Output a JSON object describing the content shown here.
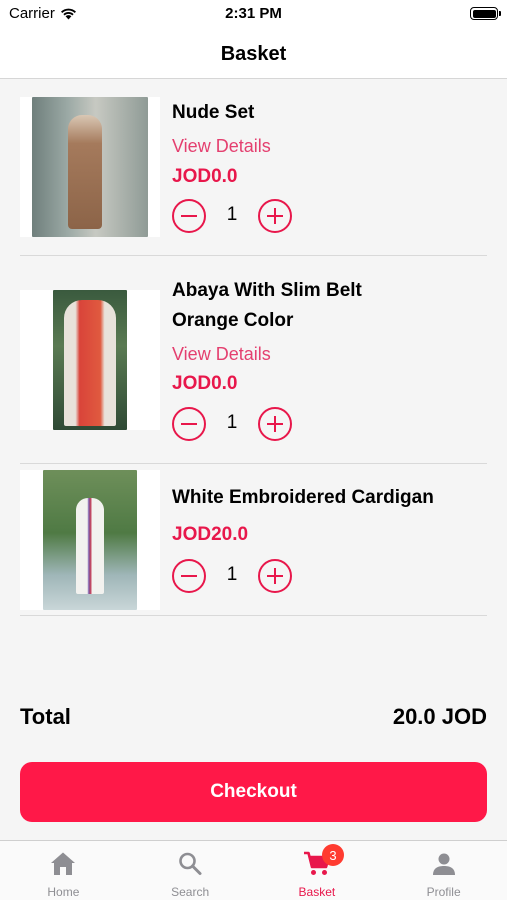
{
  "status_bar": {
    "carrier": "Carrier",
    "time": "2:31 PM"
  },
  "header": {
    "title": "Basket"
  },
  "basket": {
    "items": [
      {
        "name_lines": [
          "Nude Set"
        ],
        "view_details": "View Details",
        "price": "JOD0.0",
        "quantity": "1"
      },
      {
        "name_lines": [
          "Abaya With Slim Belt",
          "Orange Color"
        ],
        "view_details": "View Details",
        "price": "JOD0.0",
        "quantity": "1"
      },
      {
        "name_lines": [
          "White Embroidered Cardigan"
        ],
        "price": "JOD20.0",
        "quantity": "1"
      }
    ]
  },
  "summary": {
    "total_label": "Total",
    "total_value": "20.0 JOD"
  },
  "checkout_label": "Checkout",
  "tab_bar": {
    "tabs": [
      {
        "label": "Home",
        "icon": "home-icon"
      },
      {
        "label": "Search",
        "icon": "search-icon"
      },
      {
        "label": "Basket",
        "icon": "cart-icon",
        "badge": "3"
      },
      {
        "label": "Profile",
        "icon": "person-icon"
      }
    ],
    "active": "Basket"
  },
  "colors": {
    "accent": "#ff1848",
    "price": "#e8174b",
    "link": "#e43f6f",
    "badge": "#ff3b30"
  }
}
